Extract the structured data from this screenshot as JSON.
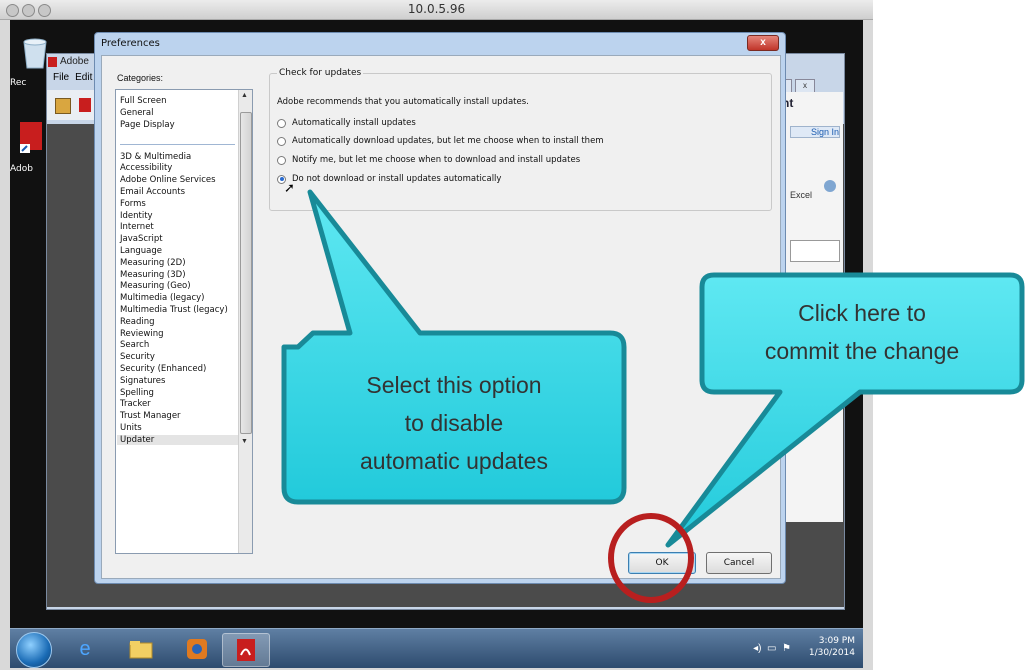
{
  "mac_window": {
    "title": "10.0.5.96"
  },
  "desktop": {
    "icons": [
      {
        "label": "Rec",
        "icon": "recycle-bin-icon"
      },
      {
        "label": "Adob",
        "icon": "adobe-reader-icon"
      }
    ]
  },
  "adobe_window": {
    "title": "Adobe",
    "menu": [
      "File",
      "Edit"
    ],
    "right_panel": {
      "comment_label": "mment",
      "sign_in": "Sign In",
      "excel": "Excel"
    }
  },
  "preferences": {
    "title": "Preferences",
    "close_label": "x",
    "categories_label": "Categories:",
    "categories_top": [
      "Full Screen",
      "General",
      "Page Display"
    ],
    "categories": [
      "3D & Multimedia",
      "Accessibility",
      "Adobe Online Services",
      "Email Accounts",
      "Forms",
      "Identity",
      "Internet",
      "JavaScript",
      "Language",
      "Measuring (2D)",
      "Measuring (3D)",
      "Measuring (Geo)",
      "Multimedia (legacy)",
      "Multimedia Trust (legacy)",
      "Reading",
      "Reviewing",
      "Search",
      "Security",
      "Security (Enhanced)",
      "Signatures",
      "Spelling",
      "Tracker",
      "Trust Manager",
      "Units",
      "Updater"
    ],
    "selected_category": "Updater",
    "check_for_updates": {
      "legend": "Check for updates",
      "recommendation": "Adobe recommends that you automatically install updates.",
      "options": [
        {
          "label": "Automatically install updates",
          "checked": false
        },
        {
          "label": "Automatically download updates, but let me choose when to install them",
          "checked": false
        },
        {
          "label": "Notify me, but let me choose when to download and install updates",
          "checked": false
        },
        {
          "label": "Do not download or install updates automatically",
          "checked": true
        }
      ]
    },
    "ok_label": "OK",
    "cancel_label": "Cancel"
  },
  "taskbar": {
    "items": [
      "start-orb-icon",
      "internet-explorer-icon",
      "file-explorer-icon",
      "media-player-icon",
      "adobe-reader-icon"
    ],
    "time": "3:09 PM",
    "date": "1/30/2014"
  },
  "callouts": {
    "select_option": [
      "Select this option",
      "to disable",
      "automatic updates"
    ],
    "commit_change": [
      "Click here to",
      "commit the change"
    ]
  },
  "colors": {
    "callout_fill": "#2ed6e6",
    "callout_border": "#1a8fa0",
    "highlight_circle": "#b81f1f"
  }
}
